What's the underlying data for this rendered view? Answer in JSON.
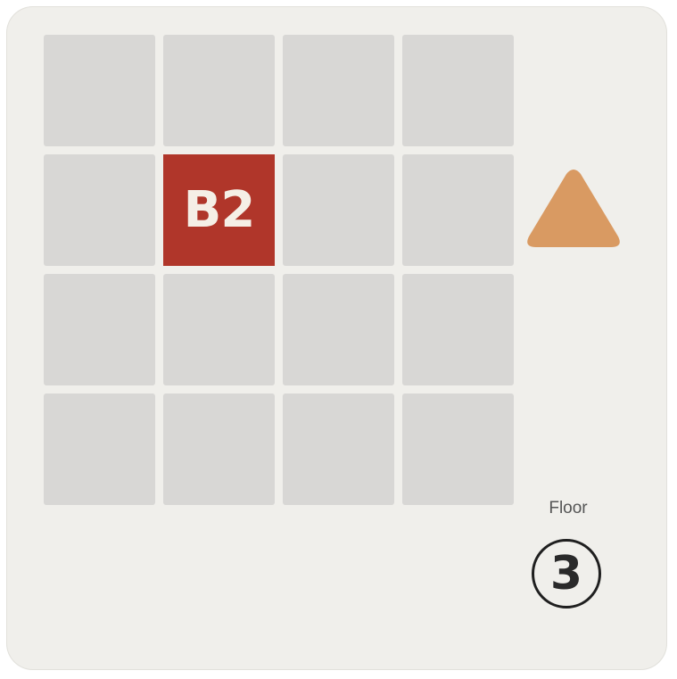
{
  "map": {
    "rows": 4,
    "columns": 4,
    "highlighted_cell": {
      "row": 2,
      "column": 2,
      "label": "B2"
    }
  },
  "direction_indicator": {
    "icon": "triangle-up-icon",
    "color": "#d99a62"
  },
  "floor": {
    "label": "Floor",
    "number": "3"
  },
  "colors": {
    "card_background": "#f0efeb",
    "cell": "#d8d7d5",
    "highlight": "#b0362a",
    "highlight_text": "#f5efe6"
  }
}
